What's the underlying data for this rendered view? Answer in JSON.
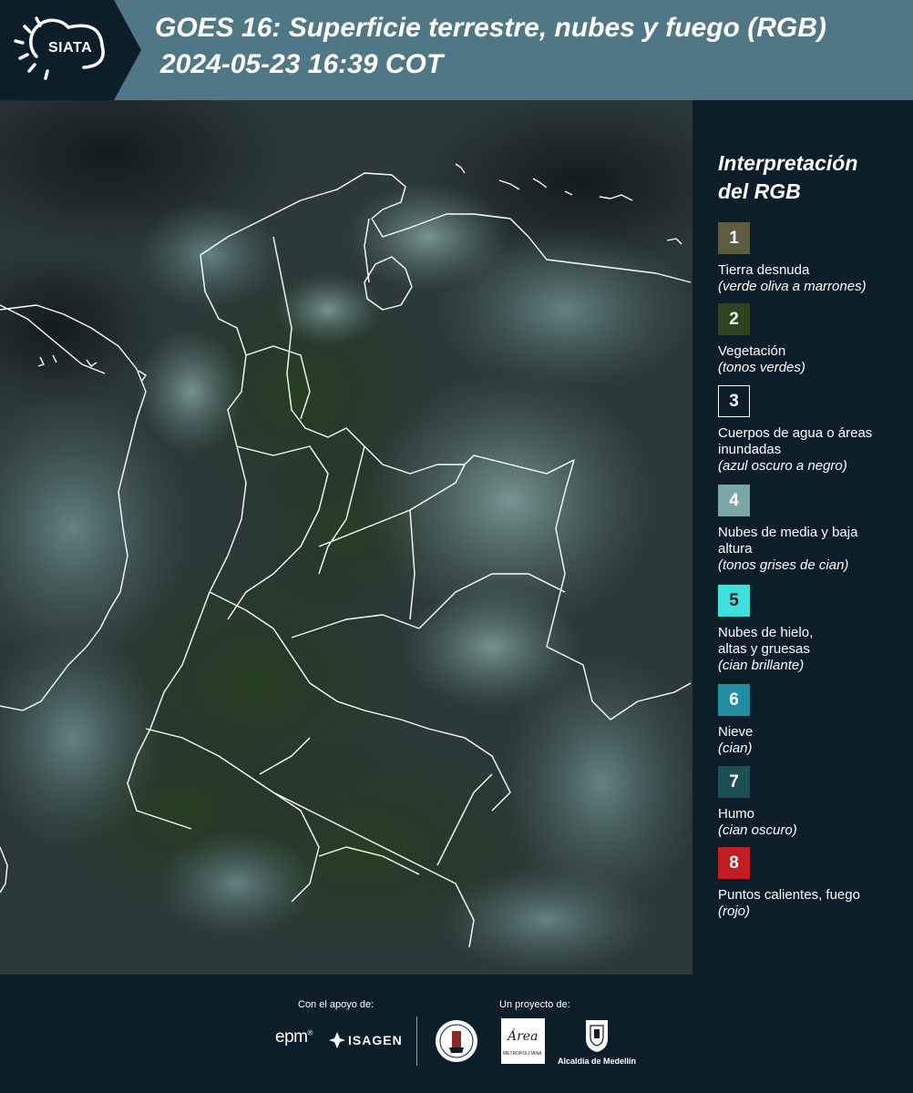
{
  "header": {
    "logo_text": "SIATA",
    "title": "GOES 16: Superficie terrestre, nubes y fuego (RGB)",
    "subtitle": "2024-05-23 16:39 COT"
  },
  "legend": {
    "title_line1": "Interpretación",
    "title_line2": "del RGB",
    "items": [
      {
        "number": "1",
        "color": "#5c5c40",
        "name": "Tierra desnuda",
        "desc": "(verde oliva a marrones)"
      },
      {
        "number": "2",
        "color": "#2e4420",
        "name": "Vegetación",
        "desc": "(tonos verdes)"
      },
      {
        "number": "3",
        "color": "#0c1e2a",
        "name": "Cuerpos de agua o áreas inundadas",
        "desc": "(azul oscuro a negro)"
      },
      {
        "number": "4",
        "color": "#7aa7a5",
        "name": "Nubes de media y baja altura",
        "desc": "(tonos grises de cian)"
      },
      {
        "number": "5",
        "color": "#3ee0dc",
        "name": "Nubes de hielo, altas y gruesas",
        "desc": "(cian brillante)"
      },
      {
        "number": "6",
        "color": "#1f8ea4",
        "name": "Nieve",
        "desc": "(cian)"
      },
      {
        "number": "7",
        "color": "#1d5052",
        "name": "Humo",
        "desc": "(cian oscuro)"
      },
      {
        "number": "8",
        "color": "#c01e22",
        "name": "Puntos calientes, fuego",
        "desc": "(rojo)"
      }
    ]
  },
  "footer": {
    "support_label": "Con el apoyo de:",
    "project_label": "Un proyecto de:",
    "epm": "epm",
    "isagen": "ISAGEN",
    "alcaldia": "Alcaldía de Medellín",
    "area_text": "Área",
    "area_sub": "METROPOLITANA"
  }
}
